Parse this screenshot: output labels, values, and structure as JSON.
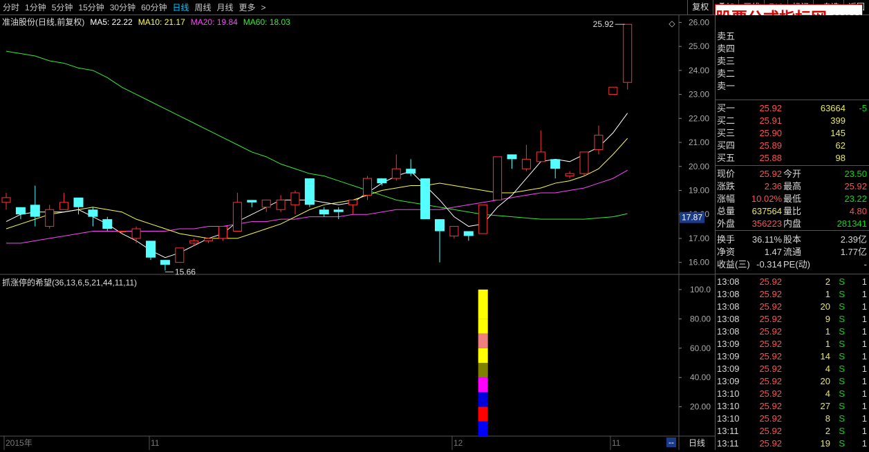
{
  "toolbar": {
    "periods": [
      "分时",
      "1分钟",
      "5分钟",
      "15分钟",
      "30分钟",
      "60分钟",
      "日线",
      "周线",
      "月线",
      "更多"
    ],
    "active": "日线",
    "more_arrow": ">",
    "right_buttons": [
      "复权",
      "叠加",
      "画线",
      "F10",
      "标记",
      "+自选",
      "返回"
    ]
  },
  "watermark": "股票公式指标网 www.gsxx.com",
  "main": {
    "title": "准油股份(日线,前复权)",
    "ma5": "MA5: 22.22",
    "ma10": "MA10: 21.17",
    "ma20": "MA20: 19.84",
    "ma60": "MA60: 18.03",
    "price_ticks": [
      "26.00",
      "25.00",
      "24.00",
      "23.00",
      "22.00",
      "21.00",
      "20.00",
      "19.00",
      "18.00",
      "17.00",
      "16.00"
    ],
    "high_label": "25.92",
    "low_label": "15.66",
    "current_tag": "17.87"
  },
  "sub": {
    "title": "抓涨停的希望(36,13,6,5,21,44,11,11)",
    "ticks": [
      "100.0",
      "80.00",
      "60.00",
      "40.00",
      "20.00"
    ]
  },
  "bottom": {
    "labels": [
      "2015年",
      "11",
      "12",
      "11"
    ],
    "period": "日线",
    "arrow": "--"
  },
  "colors": {
    "up": "#ff3333",
    "down": "#55ffff",
    "ma5": "#ffffff",
    "ma10": "#ffff44",
    "ma20": "#ff44ff",
    "ma60": "#33ee33"
  },
  "chart_data": {
    "type": "candlestick",
    "ylim": [
      15.5,
      26.3
    ],
    "candles": [
      [
        18.5,
        18.7,
        18.2,
        18.9
      ],
      [
        18.3,
        18.0,
        17.8,
        18.3
      ],
      [
        18.4,
        17.9,
        17.5,
        19.2
      ],
      [
        17.5,
        18.2,
        17.4,
        18.4
      ],
      [
        18.2,
        18.5,
        18.2,
        18.9
      ],
      [
        18.7,
        18.3,
        18.0,
        18.7
      ],
      [
        18.2,
        17.9,
        17.5,
        18.3
      ],
      [
        17.8,
        17.4,
        17.3,
        17.9
      ],
      [
        17.3,
        17.3,
        17.2,
        17.3
      ],
      [
        17.0,
        17.4,
        16.8,
        17.5
      ],
      [
        16.9,
        16.2,
        16.1,
        16.9
      ],
      [
        16.1,
        15.9,
        15.66,
        16.1
      ],
      [
        16.0,
        16.6,
        16.0,
        16.6
      ],
      [
        16.8,
        16.9,
        16.7,
        17.0
      ],
      [
        16.9,
        17.0,
        16.8,
        17.0
      ],
      [
        17.0,
        17.5,
        16.9,
        17.5
      ],
      [
        17.3,
        18.5,
        17.3,
        18.9
      ],
      [
        18.6,
        18.5,
        18.3,
        18.6
      ],
      [
        18.3,
        18.6,
        18.1,
        18.6
      ],
      [
        18.2,
        18.6,
        18.1,
        18.8
      ],
      [
        18.4,
        18.9,
        18.0,
        19.0
      ],
      [
        19.5,
        18.4,
        18.3,
        19.5
      ],
      [
        18.2,
        18.0,
        17.9,
        18.3
      ],
      [
        18.2,
        18.1,
        17.8,
        18.3
      ],
      [
        18.4,
        18.6,
        18.0,
        18.6
      ],
      [
        18.8,
        19.5,
        18.6,
        19.6
      ],
      [
        19.5,
        19.3,
        19.2,
        19.5
      ],
      [
        19.5,
        19.9,
        19.4,
        20.5
      ],
      [
        19.9,
        19.7,
        19.6,
        20.3
      ],
      [
        19.5,
        17.8,
        17.8,
        19.5
      ],
      [
        17.8,
        17.3,
        16.0,
        17.8
      ],
      [
        17.1,
        17.5,
        17.0,
        17.5
      ],
      [
        17.3,
        17.1,
        16.9,
        17.3
      ],
      [
        17.2,
        18.4,
        17.2,
        18.4
      ],
      [
        18.6,
        20.4,
        18.6,
        20.4
      ],
      [
        20.5,
        20.3,
        19.9,
        20.5
      ],
      [
        19.9,
        20.3,
        19.8,
        20.9
      ],
      [
        20.2,
        20.6,
        20.2,
        21.5
      ],
      [
        20.3,
        19.9,
        19.5,
        20.3
      ],
      [
        19.6,
        19.7,
        19.5,
        19.8
      ],
      [
        19.7,
        20.6,
        19.6,
        20.6
      ],
      [
        20.7,
        21.3,
        20.5,
        21.7
      ],
      [
        23.0,
        23.3,
        23.0,
        23.3
      ],
      [
        23.5,
        25.92,
        23.2,
        25.92
      ]
    ],
    "ma5": [
      17.7,
      18.0,
      18.1,
      18.1,
      18.1,
      18.2,
      17.9,
      17.6,
      17.2,
      16.9,
      16.5,
      16.2,
      16.4,
      16.7,
      17.0,
      17.2,
      17.7,
      18.0,
      18.3,
      18.6,
      18.6,
      18.6,
      18.5,
      18.4,
      18.5,
      18.9,
      19.3,
      19.6,
      19.8,
      19.2,
      18.6,
      17.9,
      17.5,
      17.6,
      18.3,
      18.8,
      19.5,
      20.2,
      20.3,
      20.2,
      20.5,
      20.8,
      21.4,
      22.22
    ],
    "ma10": [
      17.4,
      17.6,
      17.8,
      18.0,
      18.1,
      18.2,
      18.3,
      18.2,
      18.1,
      17.8,
      17.6,
      17.4,
      17.2,
      17.1,
      17.0,
      17.0,
      17.0,
      17.2,
      17.4,
      17.6,
      17.9,
      18.2,
      18.4,
      18.5,
      18.6,
      18.8,
      19.0,
      19.1,
      19.2,
      19.2,
      19.3,
      19.2,
      19.1,
      19.0,
      18.9,
      18.9,
      19.0,
      19.1,
      19.3,
      19.4,
      19.6,
      19.9,
      20.5,
      21.17
    ],
    "ma20": [
      16.8,
      16.8,
      16.9,
      17.0,
      17.1,
      17.2,
      17.3,
      17.3,
      17.3,
      17.3,
      17.3,
      17.3,
      17.4,
      17.4,
      17.5,
      17.5,
      17.6,
      17.7,
      17.7,
      17.8,
      17.8,
      17.9,
      17.9,
      17.9,
      18.0,
      18.0,
      18.1,
      18.2,
      18.2,
      18.2,
      18.2,
      18.3,
      18.4,
      18.5,
      18.6,
      18.7,
      18.8,
      18.9,
      18.9,
      19.0,
      19.1,
      19.3,
      19.5,
      19.84
    ],
    "ma60": [
      24.8,
      24.7,
      24.6,
      24.4,
      24.3,
      24.1,
      24.0,
      23.7,
      23.3,
      23.0,
      22.7,
      22.4,
      22.1,
      21.8,
      21.5,
      21.2,
      20.9,
      20.6,
      20.4,
      20.1,
      19.9,
      19.7,
      19.6,
      19.4,
      19.2,
      19.0,
      18.8,
      18.6,
      18.5,
      18.4,
      18.3,
      18.2,
      18.1,
      18.0,
      17.95,
      17.9,
      17.85,
      17.8,
      17.8,
      17.8,
      17.8,
      17.85,
      17.9,
      18.03
    ],
    "signal_bar": {
      "index": 33,
      "segments": [
        {
          "from": 80,
          "to": 100,
          "color": "#ffff00"
        },
        {
          "from": 70,
          "to": 80,
          "color": "#ffff00"
        },
        {
          "from": 60,
          "to": 70,
          "color": "#f08080"
        },
        {
          "from": 50,
          "to": 60,
          "color": "#ffff00"
        },
        {
          "from": 40,
          "to": 50,
          "color": "#808000"
        },
        {
          "from": 30,
          "to": 40,
          "color": "#ff00ff"
        },
        {
          "from": 20,
          "to": 30,
          "color": "#0000dd"
        },
        {
          "from": 10,
          "to": 20,
          "color": "#ff0000"
        },
        {
          "from": 0,
          "to": 10,
          "color": "#0000ff"
        }
      ]
    }
  },
  "quote": {
    "sell_labels": [
      "卖五",
      "卖四",
      "卖三",
      "卖二",
      "卖一"
    ],
    "buy": [
      {
        "label": "买一",
        "price": "25.92",
        "vol": "63664",
        "chg": "-5"
      },
      {
        "label": "买二",
        "price": "25.91",
        "vol": "399",
        "chg": ""
      },
      {
        "label": "买三",
        "price": "25.90",
        "vol": "145",
        "chg": ""
      },
      {
        "label": "买四",
        "price": "25.89",
        "vol": "62",
        "chg": ""
      },
      {
        "label": "买五",
        "price": "25.88",
        "vol": "98",
        "chg": ""
      }
    ],
    "stats": [
      {
        "l1": "现价",
        "v1": "25.92",
        "l2": "今开",
        "v2": "23.50",
        "c1": "c-red",
        "c2": "c-grn"
      },
      {
        "l1": "涨跌",
        "v1": "2.36",
        "l2": "最高",
        "v2": "25.92",
        "c1": "c-red",
        "c2": "c-red"
      },
      {
        "l1": "涨幅",
        "v1": "10.02%",
        "l2": "最低",
        "v2": "23.22",
        "c1": "c-red",
        "c2": "c-grn"
      },
      {
        "l1": "总量",
        "v1": "637564",
        "l2": "量比",
        "v2": "4.80",
        "c1": "c-yel",
        "c2": "c-red"
      },
      {
        "l1": "外盘",
        "v1": "356223",
        "l2": "内盘",
        "v2": "281341",
        "c1": "c-red",
        "c2": "c-grn"
      }
    ],
    "stats2": [
      {
        "l1": "换手",
        "v1": "36.11%",
        "l2": "股本",
        "v2": "2.39亿"
      },
      {
        "l1": "净资",
        "v1": "1.47",
        "l2": "流通",
        "v2": "1.77亿"
      },
      {
        "l1": "收益(三)",
        "v1": "-0.314",
        "l2": "PE(动)",
        "v2": "-"
      }
    ],
    "ticks": [
      [
        "13:08",
        "25.92",
        "2",
        "S",
        "1"
      ],
      [
        "13:08",
        "25.92",
        "1",
        "S",
        "1"
      ],
      [
        "13:08",
        "25.92",
        "20",
        "S",
        "1"
      ],
      [
        "13:08",
        "25.92",
        "9",
        "S",
        "1"
      ],
      [
        "13:08",
        "25.92",
        "1",
        "S",
        "1"
      ],
      [
        "13:09",
        "25.92",
        "1",
        "S",
        "1"
      ],
      [
        "13:09",
        "25.92",
        "14",
        "S",
        "1"
      ],
      [
        "13:09",
        "25.92",
        "4",
        "S",
        "1"
      ],
      [
        "13:09",
        "25.92",
        "20",
        "S",
        "1"
      ],
      [
        "13:10",
        "25.92",
        "4",
        "S",
        "1"
      ],
      [
        "13:10",
        "25.92",
        "27",
        "S",
        "1"
      ],
      [
        "13:10",
        "25.92",
        "8",
        "S",
        "1"
      ],
      [
        "13:11",
        "25.92",
        "2",
        "S",
        "1"
      ],
      [
        "13:11",
        "25.92",
        "19",
        "S",
        "1"
      ]
    ]
  }
}
